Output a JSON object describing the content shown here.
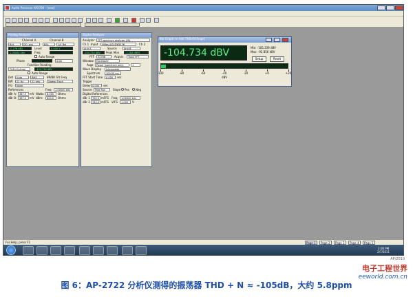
{
  "app": {
    "title": "Audio Precision AP2700 - [new]",
    "menu": [
      "File",
      "Edit",
      "View",
      "Panels",
      "Sweep",
      "Compute",
      "Macro",
      "Utilities",
      "Window",
      "Help"
    ]
  },
  "analog_analyzer": {
    "title": "Analog Analyzer",
    "channel_a": "Channel A",
    "channel_b": "Channel B",
    "input_a": "BAL",
    "coupling_a": "DC (pin)",
    "input_b": "BAL",
    "coupling_b": "1/4 Bal",
    "level_a": "-0.276 dBV",
    "level_b": "0.000 V",
    "level_label": "Level",
    "freq_a": "1.00004 kHz",
    "freq_label": "Freq",
    "auto_range": "Auto Range",
    "phase_label": "Phase",
    "phase_mode": "Auto",
    "function_reading": "Function Reading",
    "function": "THD+N Ampl",
    "function_value": "-104.734 dBV",
    "auto_range_2": "Auto Range",
    "bw_label": "BW",
    "bw": "22 Hz",
    "bw_hi": "22 kHz",
    "bpbr_label": "BP/BR Filt Freq",
    "sweep_track": "Sweep Track",
    "det_label": "Det",
    "det": "Auto",
    "det2": "RMS",
    "fltr_label": "Fltr",
    "fltr": "None",
    "freq_label2": "Freq",
    "freq_val": "1.00000 kHz",
    "references_label": "References",
    "dbr_a_label": "dBr A:",
    "dbr_a": "387.3",
    "dbr_a_unit": "mV",
    "watts_label": "Watts:",
    "watts": "8.000",
    "watts_unit": "Ohms",
    "dbr_b_label": "dBr B:",
    "dbr_b": "387.3",
    "dbr_b_unit": "mV",
    "dbm_label": "dBm:",
    "dbm": "600.0",
    "dbm_unit": "Ohms"
  },
  "digital_analyzer": {
    "title": "Digital Analyzer",
    "analyzer_label": "Analyzer",
    "analyzer": "FFT spectrum analyzer (fft)",
    "ch_a_label": "Ch 1",
    "input_label": "Input",
    "input": "HiRes A/D @65536",
    "ch_b_label": "Ch 2",
    "ana_a_label": "Anlr A",
    "source_label": "Source",
    "source": "Anlr B",
    "value_a": "-104.734 dBV",
    "peak_mon_label": "Peak Mon",
    "peak_value": "-1.284 dBFS",
    "fft_label": "FFT",
    "fft_size": "32768",
    "acquis_label": "Acquis",
    "acquis": "Track FFT",
    "window_label": "Window",
    "window": "Equiripple",
    "avg_label": "Avgs",
    "avg": "Power (spectrum only)",
    "avg_n": "1",
    "wave_display_label": "Wave Display",
    "wave_display": "Interpolate",
    "spectrum_label": "Spectrum",
    "spectrum": "100.00 ms",
    "fft_start_label": "FFT Start Time",
    "fft_start": "0.000",
    "fft_start_unit": "sec",
    "trigger_label": "Trigger",
    "delay_label": "Delay",
    "delay": "0.000",
    "delay_unit": "sec",
    "source2_label": "Source",
    "source2": "Free Run",
    "slope_label": "Slope",
    "pos": "Pos",
    "neg": "Neg",
    "digital_refs": "Digital References",
    "dbr1_label": "dBr 1",
    "dbr1": "765.9",
    "dbr1_unit": "mFFS",
    "freq_ref_label": "Freq",
    "freq_ref": "1.00000 kHz",
    "dbr2_label": "dBr 2",
    "dbr2": "765.9",
    "dbr2_unit": "mFFS",
    "vfs_label": "V/FS",
    "vfs": "1.000",
    "vfs_unit": "V"
  },
  "bar_graph": {
    "title": "Bar Graph (< Anlr THD+N Ampl)",
    "reading": "-104.734 dBV",
    "min": "Min: -105.339 dBV",
    "max": "Max: -92.856 dBV",
    "setup": "Setup",
    "reset": "Reset",
    "ticks": [
      "-100",
      "-80",
      "-60",
      "-40",
      "-20",
      "+0",
      "+20"
    ],
    "unit": "dBV",
    "fill_fraction": 0.04
  },
  "status": {
    "help": "For Help, press F1",
    "pages": [
      "Page 1",
      "Page 2",
      "Page 3",
      "Page 4",
      "Page 5"
    ]
  },
  "taskbar": {
    "time": "2:08 PM",
    "date": "2/7/2011"
  },
  "caption": "图 6：AP-2722 分析仪测得的振荡器 THD + N ≈ -105dB，大约 5.8ppm",
  "watermark": {
    "cn": "电子工程世界",
    "site": "eeworld.com.cn"
  },
  "build_id": "AP/2010"
}
